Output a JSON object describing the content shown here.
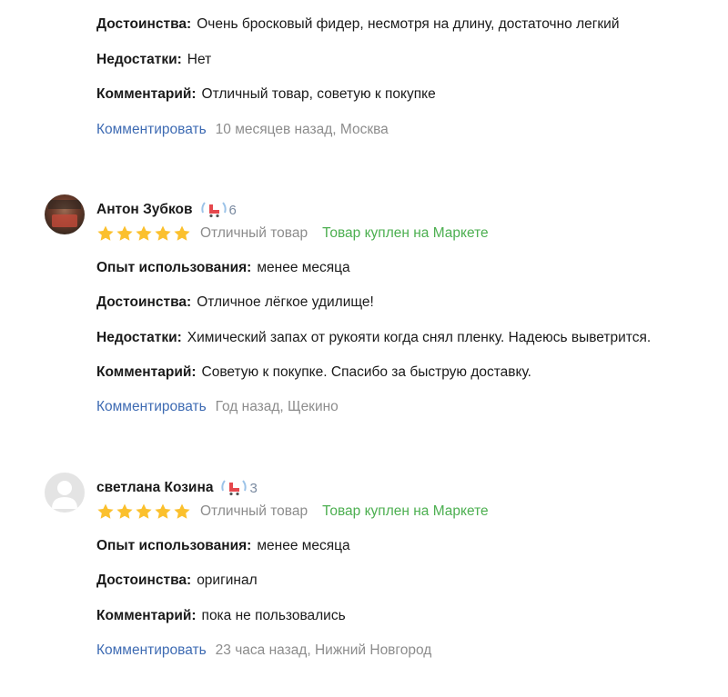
{
  "colors": {
    "link": "#3e6bb3",
    "muted": "#8c8c8c",
    "purchased": "#4caf50",
    "star": "#fbc02d"
  },
  "labels": {
    "advantages": "Достоинства:",
    "disadvantages": "Недостатки:",
    "comment": "Комментарий:",
    "experience": "Опыт использования:",
    "reply": "Комментировать"
  },
  "reviews": [
    {
      "advantages": "Очень бросковый фидер, несмотря на длину, достаточно легкий",
      "disadvantages": "Нет",
      "comment": "Отличный товар, советую к покупке",
      "meta": "10 месяцев назад, Москва"
    },
    {
      "author": "Антон Зубков",
      "badge_count": "6",
      "badge_icon": "roller-skate-badge-icon",
      "rating": 5,
      "rating_text": "Отличный товар",
      "purchased": "Товар куплен на Маркете",
      "experience": "менее месяца",
      "advantages": "Отличное лёгкое удилище!",
      "disadvantages": "Химический запах от рукояти когда снял пленку. Надеюсь выветрится.",
      "comment": "Советую к покупке. Спасибо за быструю доставку.",
      "meta": "Год назад, Щекино"
    },
    {
      "author": "светлана Козина",
      "badge_count": "3",
      "badge_icon": "roller-skate-badge-icon",
      "rating": 5,
      "rating_text": "Отличный товар",
      "purchased": "Товар куплен на Маркете",
      "experience": "менее месяца",
      "advantages": "оригинал",
      "comment": "пока не пользовались",
      "meta": "23 часа назад, Нижний Новгород"
    }
  ]
}
